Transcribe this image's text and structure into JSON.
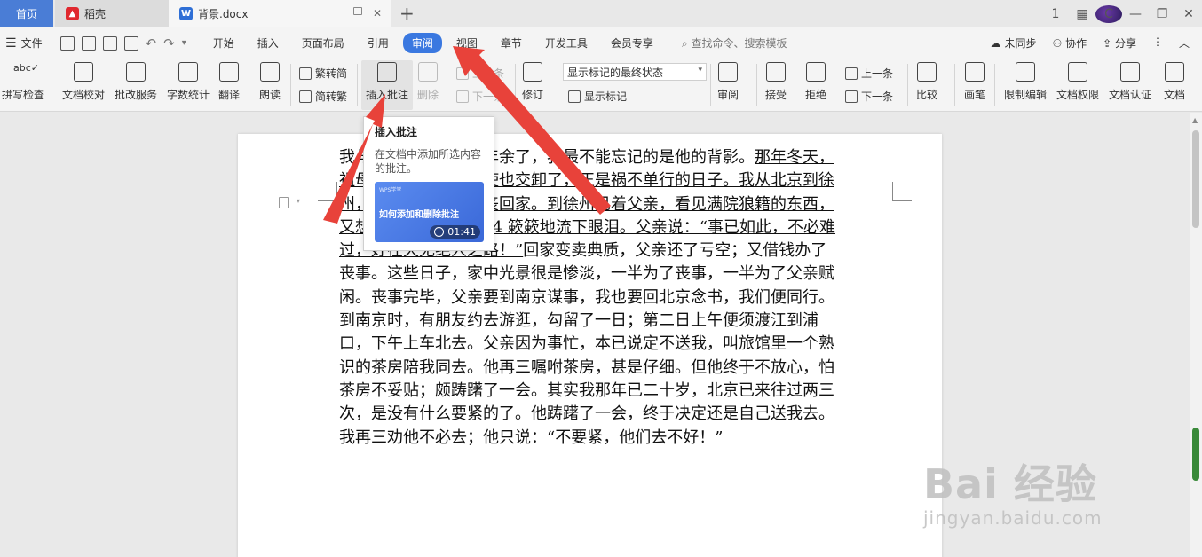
{
  "titlebar": {
    "home_tab": "首页",
    "tabs": [
      {
        "label": "稻壳",
        "icon_color": "#e0282e"
      },
      {
        "label": "背景.docx",
        "icon_color": "#2f6fd6"
      }
    ],
    "new_tab": "+",
    "window_controls": [
      "1",
      "▦",
      "C",
      "—",
      "❐",
      "✕"
    ]
  },
  "menubar": {
    "file_label": "文件",
    "tabs": [
      "开始",
      "插入",
      "页面布局",
      "引用",
      "审阅",
      "视图",
      "章节",
      "开发工具",
      "会员专享"
    ],
    "active_tab": "审阅",
    "search_placeholder": "查找命令、搜索模板",
    "sync": "未同步",
    "collaborate": "协作",
    "share": "分享"
  },
  "ribbon": {
    "spell_check": "拼写检查",
    "doc_proof": "文档校对",
    "correction_service": "批改服务",
    "word_count": "字数统计",
    "translate": "翻译",
    "read_aloud": "朗读",
    "trad_to_simp": "繁转简",
    "simp_to_trad": "简转繁",
    "insert_comment": "插入批注",
    "delete": "删除",
    "prev": "上一条",
    "next": "下一条",
    "revise": "修订",
    "display_mode": "显示标记的最终状态",
    "show_markup": "显示标记",
    "review": "审阅",
    "accept": "接受",
    "reject": "拒绝",
    "prev2": "上一条",
    "next2": "下一条",
    "compare": "比较",
    "ink": "画笔",
    "restrict_edit": "限制编辑",
    "doc_permission": "文档权限",
    "doc_cert": "文档认证",
    "doc_more": "文档"
  },
  "tooltip": {
    "title": "插入批注",
    "description": "在文档中添加所选内容的批注。",
    "video_tag": "WPS学堂",
    "video_title": "如何添加和删除批注",
    "duration": "01:41"
  },
  "document": {
    "lines": [
      {
        "a": "我与父亲不相见已二年余了，我最不能忘记的是他的背影。",
        "u": "那年冬天，"
      },
      {
        "a": "",
        "u": "祖母死了，父亲的差使也交卸了，正是祸不单行的日子。我从北京到徐"
      },
      {
        "a": "",
        "u": "州，打算跟着父亲奔丧回家。到徐州见着父亲，看见满院狼籍的东西，"
      },
      {
        "a": "",
        "u": "又想起祖母，不禁 124 簌簌地流下眼泪。父亲说：“事已如此，不必难"
      },
      {
        "a": "",
        "u": "过，好在天无绝人之路！”",
        "b": "回家变卖典质，父亲还了亏空；又借钱办了"
      },
      {
        "a": "丧事。这些日子，家中光景很是惨淡，一半为了丧事，一半为了父亲赋"
      },
      {
        "a": "闲。丧事完毕，父亲要到南京谋事，我也要回北京念书，我们便同行。"
      },
      {
        "a": "到南京时，有朋友约去游逛，勾留了一日；第二日上午便须渡江到浦"
      },
      {
        "a": "口，下午上车北去。父亲因为事忙，本已说定不送我，叫旅馆里一个熟"
      },
      {
        "a": "识的茶房陪我同去。他再三嘱咐茶房，甚是仔细。但他终于不放心，怕"
      },
      {
        "a": "茶房不妥贴；颇踌躇了一会。其实我那年已二十岁，北京已来往过两三"
      },
      {
        "a": "次，是没有什么要紧的了。他踌躇了一会，终于决定还是自己送我去。"
      },
      {
        "a": "我再三劝他不必去；他只说：“不要紧，他们去不好！”"
      }
    ]
  },
  "watermark": {
    "logo": "Bai 经验",
    "url": "jingyan.baidu.com"
  },
  "colors": {
    "accent": "#3a78e0",
    "arrow": "#e8423a"
  }
}
